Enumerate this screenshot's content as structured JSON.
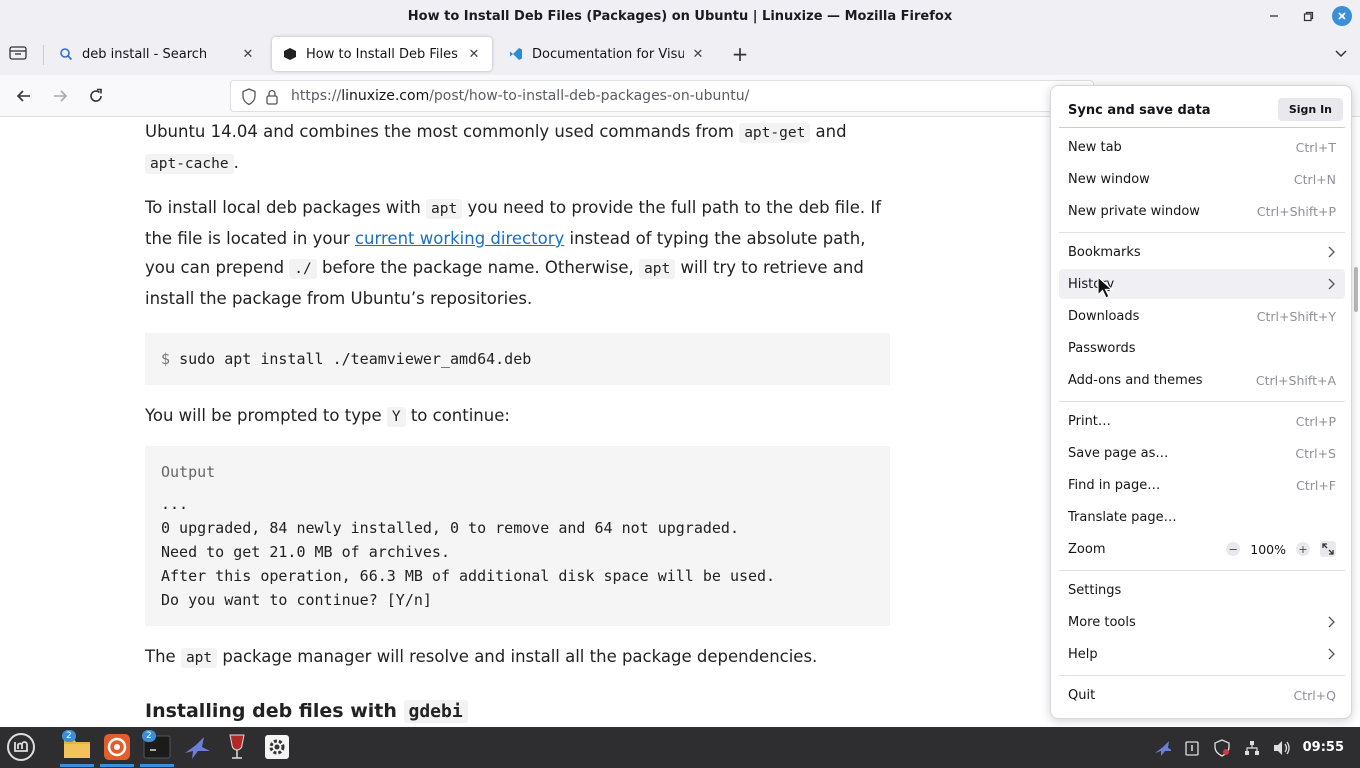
{
  "window": {
    "title": "How to Install Deb Files (Packages) on Ubuntu | Linuxize — Mozilla Firefox",
    "controls": [
      "minimize-icon",
      "maximize-icon",
      "close-icon"
    ]
  },
  "tabs": [
    {
      "label": "deb install - Search",
      "icon": "search-icon",
      "active": false
    },
    {
      "label": "How to Install Deb Files (Pa",
      "icon": "linuxize-icon",
      "active": true
    },
    {
      "label": "Documentation for Visual S",
      "icon": "vscode-icon",
      "active": false
    }
  ],
  "nav": {
    "url_prefix": "https://",
    "url_domain": "linuxize.com",
    "url_path": "/post/how-to-install-deb-packages-on-ubuntu/"
  },
  "article": {
    "p1_a": "Ubuntu 14.04 and combines the most commonly used commands from ",
    "p1_code1": "apt-get",
    "p1_b": " and ",
    "p1_code2": "apt-cache",
    "p1_c": ".",
    "p2_a": "To install local deb packages with ",
    "p2_code1": "apt",
    "p2_b": " you need to provide the full path to the deb file. If the file is located in your ",
    "p2_link": "current working directory",
    "p2_c": " instead of typing the absolute path, you can prepend ",
    "p2_code2": "./",
    "p2_d": " before the package name. Otherwise, ",
    "p2_code3": "apt",
    "p2_e": " will try to retrieve and install the package from Ubuntu’s repositories.",
    "code1_prompt": "$",
    "code1_cmd": "sudo apt install ./teamviewer_amd64.deb",
    "p3_a": "You will be prompted to type ",
    "p3_code": "Y",
    "p3_b": " to continue:",
    "output_label": "Output",
    "output_lines": [
      "...",
      "0 upgraded, 84 newly installed, 0 to remove and 64 not upgraded.",
      "Need to get 21.0 MB of archives.",
      "After this operation, 66.3 MB of additional disk space will be used.",
      "Do you want to continue? [Y/n]"
    ],
    "p4_a": "The ",
    "p4_code": "apt",
    "p4_b": " package manager will resolve and install all the package dependencies.",
    "h3_a": "Installing deb files with ",
    "h3_code": "gdebi"
  },
  "menu": {
    "header": "Sync and save data",
    "signin": "Sign In",
    "items": [
      {
        "label": "New tab",
        "shortcut": "Ctrl+T"
      },
      {
        "label": "New window",
        "shortcut": "Ctrl+N"
      },
      {
        "label": "New private window",
        "shortcut": "Ctrl+Shift+P"
      },
      {
        "label": "Bookmarks",
        "shortcut": ""
      },
      {
        "label": "History",
        "shortcut": ""
      },
      {
        "label": "Downloads",
        "shortcut": "Ctrl+Shift+Y"
      },
      {
        "label": "Passwords",
        "shortcut": ""
      },
      {
        "label": "Add-ons and themes",
        "shortcut": "Ctrl+Shift+A"
      },
      {
        "label": "Print…",
        "shortcut": "Ctrl+P"
      },
      {
        "label": "Save page as…",
        "shortcut": "Ctrl+S"
      },
      {
        "label": "Find in page…",
        "shortcut": "Ctrl+F"
      },
      {
        "label": "Translate page…",
        "shortcut": ""
      },
      {
        "label": "Zoom",
        "shortcut": ""
      },
      {
        "label": "Settings",
        "shortcut": ""
      },
      {
        "label": "More tools",
        "shortcut": ""
      },
      {
        "label": "Help",
        "shortcut": ""
      },
      {
        "label": "Quit",
        "shortcut": "Ctrl+Q"
      }
    ],
    "zoom_value": "100%"
  },
  "taskbar": {
    "apps": [
      {
        "name": "mint-menu",
        "badge": ""
      },
      {
        "name": "file-manager",
        "badge": "2"
      },
      {
        "name": "firefox",
        "badge": ""
      },
      {
        "name": "terminal",
        "badge": "2"
      },
      {
        "name": "app-bird",
        "badge": ""
      },
      {
        "name": "app-wine",
        "badge": ""
      },
      {
        "name": "settings",
        "badge": ""
      }
    ],
    "clock": "09:55",
    "accent": "#3b8fd8"
  }
}
